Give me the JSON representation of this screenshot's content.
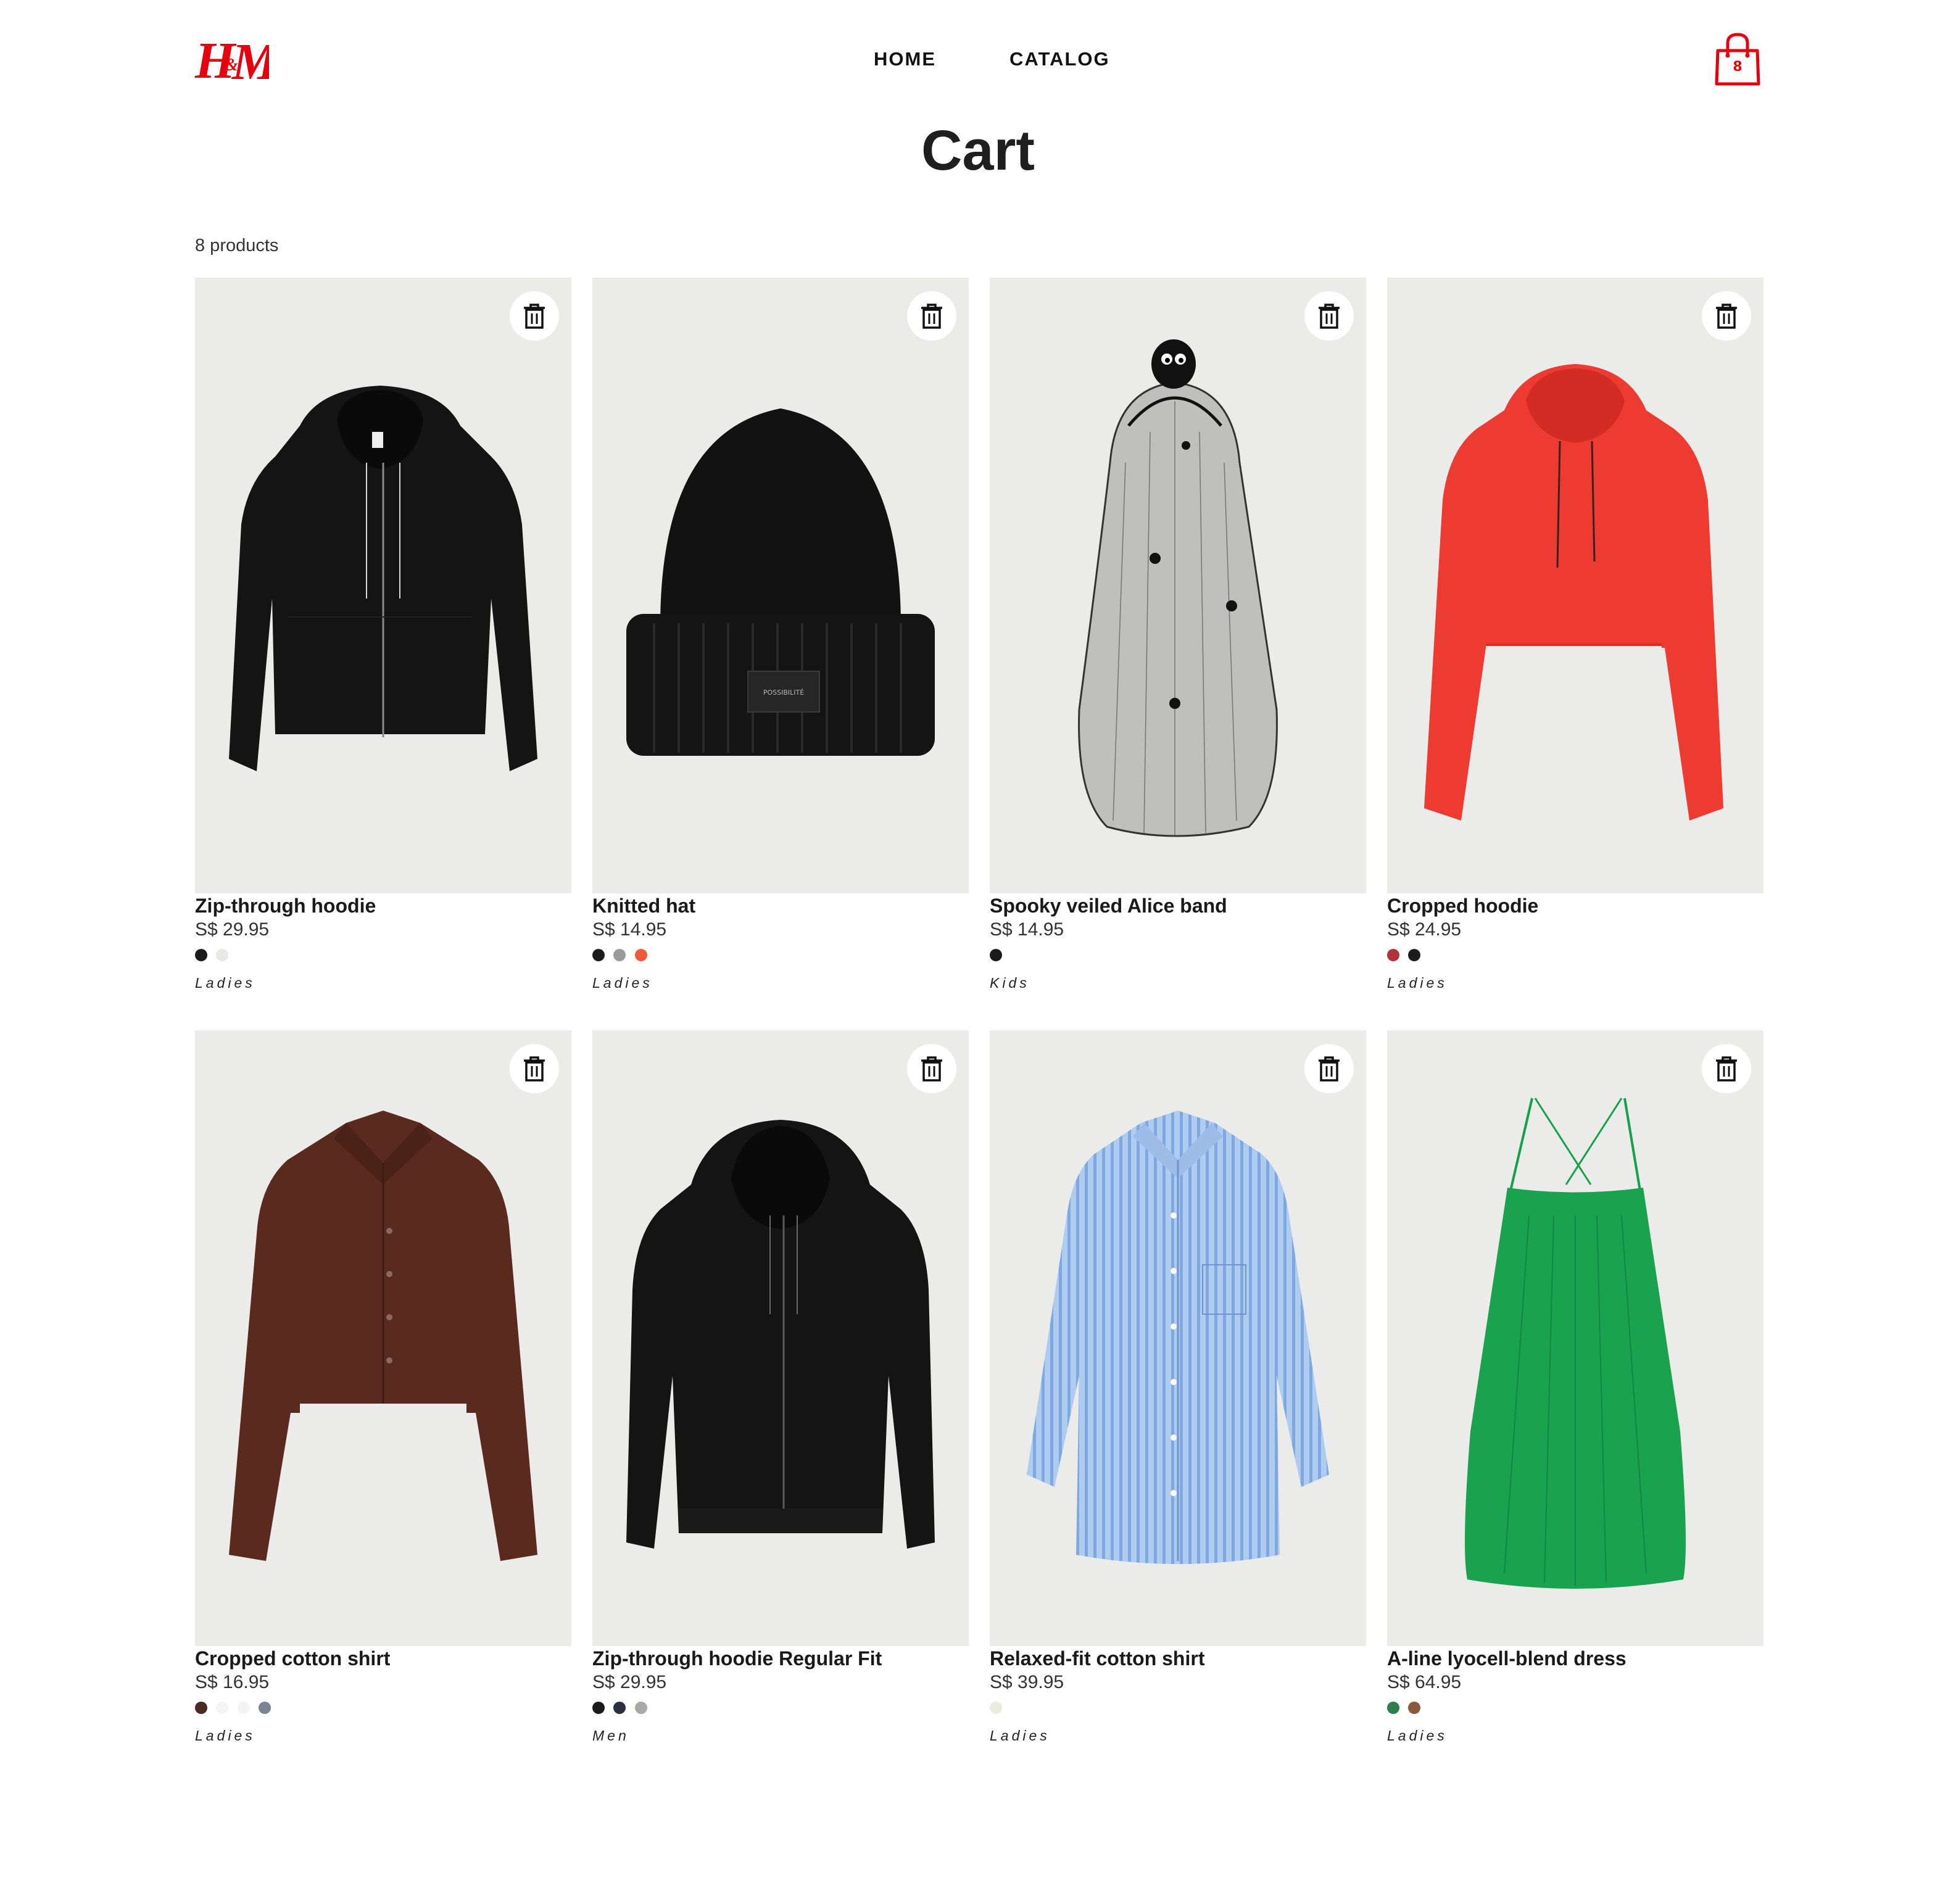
{
  "header": {
    "logo_text": "H&M",
    "nav": {
      "home": "HOME",
      "catalog": "CATALOG"
    },
    "cart_count": "8"
  },
  "page": {
    "title": "Cart",
    "product_count": "8 products"
  },
  "colors": {
    "brand_red": "#e50010",
    "image_background": "#ebebea",
    "text": "#222222"
  },
  "products": [
    {
      "name": "Zip-through hoodie",
      "price": "S$ 29.95",
      "category": "Ladies",
      "image": "black zip-through hoodie",
      "swatches": [
        "#1c1c1c",
        "#e8e8e4"
      ]
    },
    {
      "name": "Knitted hat",
      "price": "S$ 14.95",
      "category": "Ladies",
      "image": "black knitted beanie",
      "image_label": "POSSIBILITÉ",
      "swatches": [
        "#1c1c1c",
        "#9a9a9a",
        "#f05a3a"
      ]
    },
    {
      "name": "Spooky veiled Alice band",
      "price": "S$ 14.95",
      "category": "Kids",
      "image": "spider veil headband",
      "swatches": [
        "#1c1c1c"
      ]
    },
    {
      "name": "Cropped hoodie",
      "price": "S$ 24.95",
      "category": "Ladies",
      "image": "red cropped hoodie",
      "swatches": [
        "#b2323a",
        "#1c1c1c"
      ]
    },
    {
      "name": "Cropped cotton shirt",
      "price": "S$ 16.95",
      "category": "Ladies",
      "image": "brown cropped shirt",
      "swatches": [
        "#4a2a22",
        "#f4f4f2",
        "#f4f4f2",
        "#7b8591"
      ]
    },
    {
      "name": "Zip-through hoodie Regular Fit",
      "price": "S$ 29.95",
      "category": "Men",
      "image": "black men's zip hoodie",
      "swatches": [
        "#1c1c1c",
        "#2a3040",
        "#a8a8a4"
      ]
    },
    {
      "name": "Relaxed-fit cotton shirt",
      "price": "S$ 39.95",
      "category": "Ladies",
      "image": "blue striped shirt",
      "swatches": [
        "#e9ebe0"
      ]
    },
    {
      "name": "A-line lyocell-blend dress",
      "price": "S$ 64.95",
      "category": "Ladies",
      "image": "green strappy dress",
      "swatches": [
        "#2e7d4a",
        "#8a5a3c"
      ]
    }
  ]
}
